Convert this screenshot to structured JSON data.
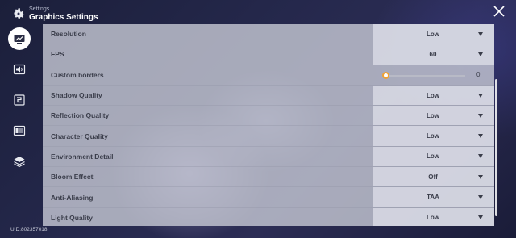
{
  "header": {
    "subtitle": "Settings",
    "title": "Graphics Settings"
  },
  "icons": {
    "settings": "gear-icon",
    "close": "close-icon",
    "nav": [
      "display-icon",
      "sound-icon",
      "controls-icon",
      "language-icon",
      "layers-icon"
    ]
  },
  "settings": [
    {
      "label": "Resolution",
      "value": "Low"
    },
    {
      "label": "FPS",
      "value": "60"
    },
    {
      "label": "Custom borders",
      "slider_value": "0",
      "slider_level": 0
    },
    {
      "label": "Shadow Quality",
      "value": "Low"
    },
    {
      "label": "Reflection Quality",
      "value": "Low"
    },
    {
      "label": "Character Quality",
      "value": "Low"
    },
    {
      "label": "Environment Detail",
      "value": "Low"
    },
    {
      "label": "Bloom Effect",
      "value": "Off"
    },
    {
      "label": "Anti-Aliasing",
      "value": "TAA"
    },
    {
      "label": "Light Quality",
      "value": "Low"
    }
  ],
  "footer": {
    "uid": "UID:802357018"
  },
  "colors": {
    "slider_accent": "#f0a131",
    "row_bg": "#c8cad6",
    "text_dark": "#3a3d4a"
  }
}
